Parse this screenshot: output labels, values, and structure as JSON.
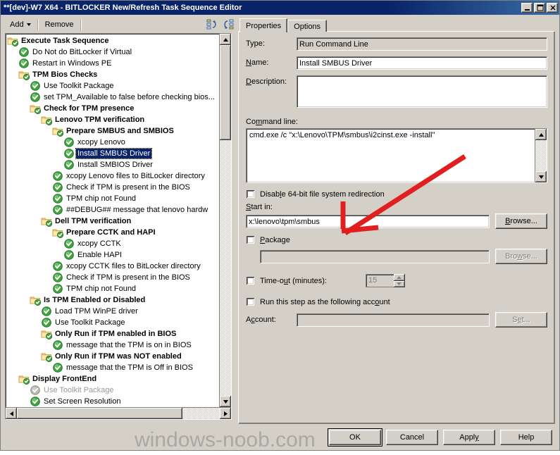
{
  "window": {
    "title": "**[dev]-W7 X64 - BITLOCKER New/Refresh Task Sequence Editor",
    "minimize_label": "minimize",
    "maximize_label": "maximize",
    "close_label": "close"
  },
  "toolbar": {
    "add_label": "Add",
    "remove_label": "Remove",
    "icon1_name": "move-up-icon",
    "icon2_name": "move-down-icon"
  },
  "tree": {
    "nodes": [
      {
        "label": "Execute Task Sequence",
        "depth": 0,
        "type": "folder",
        "state": "normal"
      },
      {
        "label": "Do Not do BitLocker if Virtual",
        "depth": 1,
        "type": "step",
        "state": "normal"
      },
      {
        "label": "Restart in Windows PE",
        "depth": 1,
        "type": "step",
        "state": "normal"
      },
      {
        "label": "TPM Bios Checks",
        "depth": 1,
        "type": "folder",
        "state": "normal"
      },
      {
        "label": "Use Toolkit Package",
        "depth": 2,
        "type": "step",
        "state": "normal"
      },
      {
        "label": "set TPM_Available to false before checking bios...",
        "depth": 2,
        "type": "step",
        "state": "normal"
      },
      {
        "label": "Check for TPM presence",
        "depth": 2,
        "type": "folder",
        "state": "normal"
      },
      {
        "label": "Lenovo TPM verification",
        "depth": 3,
        "type": "folder",
        "state": "normal"
      },
      {
        "label": "Prepare SMBUS and SMBIOS",
        "depth": 4,
        "type": "folder",
        "state": "normal"
      },
      {
        "label": "xcopy Lenovo",
        "depth": 5,
        "type": "step",
        "state": "normal"
      },
      {
        "label": "Install SMBUS Driver",
        "depth": 5,
        "type": "step",
        "state": "selected"
      },
      {
        "label": "Install SMBIOS Driver",
        "depth": 5,
        "type": "step",
        "state": "normal"
      },
      {
        "label": "xcopy Lenovo files to BitLocker directory",
        "depth": 4,
        "type": "step",
        "state": "normal"
      },
      {
        "label": "Check if TPM is present in the BIOS",
        "depth": 4,
        "type": "step",
        "state": "normal"
      },
      {
        "label": "TPM chip not Found",
        "depth": 4,
        "type": "step",
        "state": "normal"
      },
      {
        "label": "##DEBUG## message that lenovo hardw",
        "depth": 4,
        "type": "step",
        "state": "normal"
      },
      {
        "label": "Dell TPM verification",
        "depth": 3,
        "type": "folder",
        "state": "normal"
      },
      {
        "label": "Prepare CCTK and HAPI",
        "depth": 4,
        "type": "folder",
        "state": "normal"
      },
      {
        "label": "xcopy CCTK",
        "depth": 5,
        "type": "step",
        "state": "normal"
      },
      {
        "label": "Enable HAPI",
        "depth": 5,
        "type": "step",
        "state": "normal"
      },
      {
        "label": "xcopy CCTK files to BitLocker directory",
        "depth": 4,
        "type": "step",
        "state": "normal"
      },
      {
        "label": "Check if TPM is present in the BIOS",
        "depth": 4,
        "type": "step",
        "state": "normal"
      },
      {
        "label": "TPM chip not Found",
        "depth": 4,
        "type": "step",
        "state": "normal"
      },
      {
        "label": "Is TPM Enabled or Disabled",
        "depth": 2,
        "type": "folder",
        "state": "normal"
      },
      {
        "label": "Load TPM WinPE driver",
        "depth": 3,
        "type": "step",
        "state": "normal"
      },
      {
        "label": "Use Toolkit Package",
        "depth": 3,
        "type": "step",
        "state": "normal"
      },
      {
        "label": "Only Run if TPM enabled in BIOS",
        "depth": 3,
        "type": "folder",
        "state": "normal"
      },
      {
        "label": "message that the  TPM is on in BIOS",
        "depth": 4,
        "type": "step",
        "state": "normal"
      },
      {
        "label": "Only Run if TPM was NOT enabled",
        "depth": 3,
        "type": "folder",
        "state": "normal"
      },
      {
        "label": "message that the  TPM is Off in BIOS",
        "depth": 4,
        "type": "step",
        "state": "normal"
      },
      {
        "label": "Display FrontEnd",
        "depth": 1,
        "type": "folder",
        "state": "normal"
      },
      {
        "label": "Use Toolkit Package",
        "depth": 2,
        "type": "step",
        "state": "disabled"
      },
      {
        "label": "Set Screen Resolution",
        "depth": 2,
        "type": "step",
        "state": "normal"
      }
    ]
  },
  "tabs": [
    {
      "label": "Properties",
      "active": true
    },
    {
      "label": "Options",
      "active": false
    }
  ],
  "properties": {
    "type_label": "Type:",
    "type_value": "Run Command Line",
    "name_label": "Name:",
    "name_value": "Install SMBUS Driver",
    "description_label": "Description:",
    "description_value": "",
    "command_line_label": "Command line:",
    "command_line_value": "cmd.exe /c \"x:\\Lenovo\\TPM\\smbus\\i2cinst.exe -install\"",
    "disable_redirection_label": "Disable 64-bit file system redirection",
    "disable_redirection_checked": false,
    "start_in_label": "Start in:",
    "start_in_value": "x:\\lenovo\\tpm\\smbus",
    "start_in_browse_label": "Browse...",
    "package_label": "Package",
    "package_checked": false,
    "package_value": "",
    "package_browse_label": "Browse...",
    "timeout_label": "Time-out (minutes):",
    "timeout_checked": false,
    "timeout_value": "15",
    "run_as_label": "Run this step as the following account",
    "run_as_checked": false,
    "account_label": "Account:",
    "account_value": "",
    "account_set_label": "Set..."
  },
  "buttons": {
    "ok": "OK",
    "cancel": "Cancel",
    "apply": "Apply",
    "help": "Help"
  },
  "watermark": "windows-noob.com",
  "annotation": {
    "type": "red-arrow",
    "color": "#e02020",
    "points_to": "start-in-field"
  },
  "colors": {
    "titlebar": "#0a246a",
    "window_face": "#d4d0c8",
    "selection": "#0a246a",
    "annotation_red": "#e02020"
  }
}
